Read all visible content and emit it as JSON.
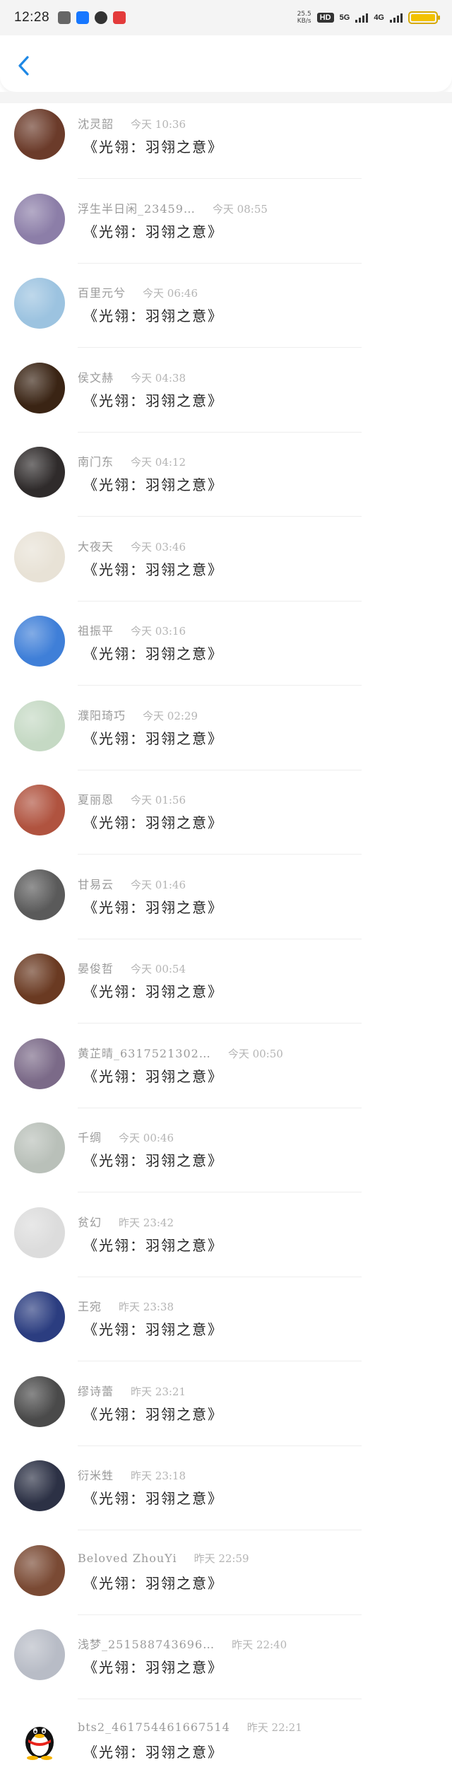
{
  "status_bar": {
    "time": "12:28",
    "net_speed_value": "25.5",
    "net_speed_unit": "KB/s",
    "hd_badge": "HD",
    "sim_labels": [
      "1",
      "2"
    ],
    "network_1": "5G",
    "network_2": "4G",
    "app_icons": [
      "game-icon",
      "alipay-icon",
      "browser-icon",
      "news-icon"
    ],
    "app_icon_colors": [
      "#666666",
      "#1677ff",
      "#333333",
      "#e33b3b"
    ]
  },
  "header": {
    "back_icon": "chevron-left-icon",
    "accent_color": "#1e88e5"
  },
  "items": [
    {
      "name": "沈灵韶",
      "time": "今天 10:36",
      "message": "《光翎：羽翎之意》",
      "avatar_color": "#6b3b2a"
    },
    {
      "name": "浮生半日闲_23459…",
      "time": "今天 08:55",
      "message": "《光翎：羽翎之意》",
      "avatar_color": "#8c7ea8"
    },
    {
      "name": "百里元兮",
      "time": "今天 06:46",
      "message": "《光翎：羽翎之意》",
      "avatar_color": "#9cc3e0"
    },
    {
      "name": "侯文赫",
      "time": "今天 04:38",
      "message": "《光翎：羽翎之意》",
      "avatar_color": "#3a2414"
    },
    {
      "name": "南门东",
      "time": "今天 04:12",
      "message": "《光翎：羽翎之意》",
      "avatar_color": "#2f2b2b"
    },
    {
      "name": "大夜天",
      "time": "今天 03:46",
      "message": "《光翎：羽翎之意》",
      "avatar_color": "#e8e2d6"
    },
    {
      "name": "祖振平",
      "time": "今天 03:16",
      "message": "《光翎：羽翎之意》",
      "avatar_color": "#3f7fd8"
    },
    {
      "name": "濮阳琦巧",
      "time": "今天 02:29",
      "message": "《光翎：羽翎之意》",
      "avatar_color": "#c5d9c4"
    },
    {
      "name": "夏丽恩",
      "time": "今天 01:56",
      "message": "《光翎：羽翎之意》",
      "avatar_color": "#b0533f"
    },
    {
      "name": "甘易云",
      "time": "今天 01:46",
      "message": "《光翎：羽翎之意》",
      "avatar_color": "#5a5a5a"
    },
    {
      "name": "晏俊哲",
      "time": "今天 00:54",
      "message": "《光翎：羽翎之意》",
      "avatar_color": "#6a3a22"
    },
    {
      "name": "黄芷晴_6317521302…",
      "time": "今天 00:50",
      "message": "《光翎：羽翎之意》",
      "avatar_color": "#7b6a88"
    },
    {
      "name": "千绸",
      "time": "今天 00:46",
      "message": "《光翎：羽翎之意》",
      "avatar_color": "#b9c0b9"
    },
    {
      "name": "贫幻",
      "time": "昨天 23:42",
      "message": "《光翎：羽翎之意》",
      "avatar_color": "#dcdcdc"
    },
    {
      "name": "王宛",
      "time": "昨天 23:38",
      "message": "《光翎：羽翎之意》",
      "avatar_color": "#2b3d80"
    },
    {
      "name": "缪诗蕾",
      "time": "昨天 23:21",
      "message": "《光翎：羽翎之意》",
      "avatar_color": "#4a4a4a"
    },
    {
      "name": "衍米甡",
      "time": "昨天 23:18",
      "message": "《光翎：羽翎之意》",
      "avatar_color": "#2c3145"
    },
    {
      "name": "Beloved ZhouYi",
      "time": "昨天 22:59",
      "message": "《光翎：羽翎之意》",
      "avatar_color": "#7a4a34"
    },
    {
      "name": "浅梦_251588743696…",
      "time": "昨天 22:40",
      "message": "《光翎：羽翎之意》",
      "avatar_color": "#b8bcc6"
    },
    {
      "name": "bts2_4617544616675​14",
      "time": "昨天 22:21",
      "message": "《光翎：羽翎之意》",
      "avatar_color": "#ffffff",
      "avatar_icon": "penguin-icon"
    }
  ]
}
